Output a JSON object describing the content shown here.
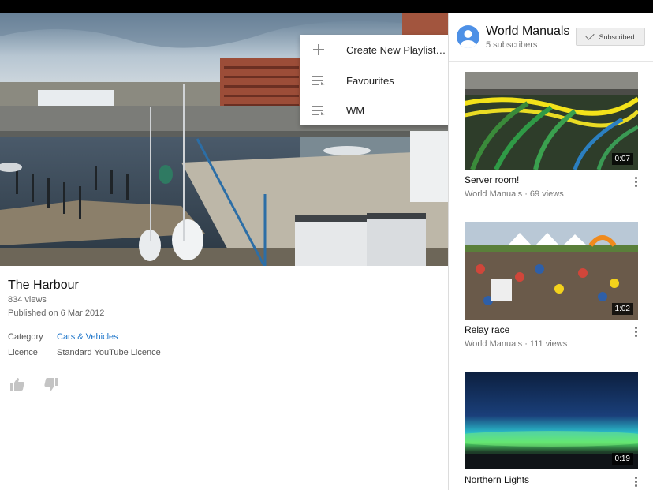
{
  "menu": {
    "items": [
      {
        "label": "Create New Playlist…",
        "icon": "plus-icon"
      },
      {
        "label": "Favourites",
        "icon": "playlist-icon"
      },
      {
        "label": "WM",
        "icon": "playlist-icon"
      }
    ]
  },
  "video": {
    "title": "The Harbour",
    "views": "834 views",
    "published": "Published on 6 Mar 2012",
    "category_label": "Category",
    "category_value": "Cars & Vehicles",
    "licence_label": "Licence",
    "licence_value": "Standard YouTube Licence",
    "like_icon": "thumbs-up-icon",
    "dislike_icon": "thumbs-down-icon"
  },
  "channel": {
    "name": "World Manuals",
    "subscribers": "5 subscribers",
    "subscribe_label": "Subscribed"
  },
  "related": [
    {
      "title": "Server room!",
      "meta": "World Manuals · 69 views",
      "duration": "0:07"
    },
    {
      "title": "Relay race",
      "meta": "World Manuals · 111 views",
      "duration": "1:02"
    },
    {
      "title": "Northern Lights",
      "meta": "",
      "duration": "0:19"
    }
  ],
  "colors": {
    "link": "#1a73c9",
    "avatar": "#4d90e6",
    "divider": "#dcdcdc"
  }
}
